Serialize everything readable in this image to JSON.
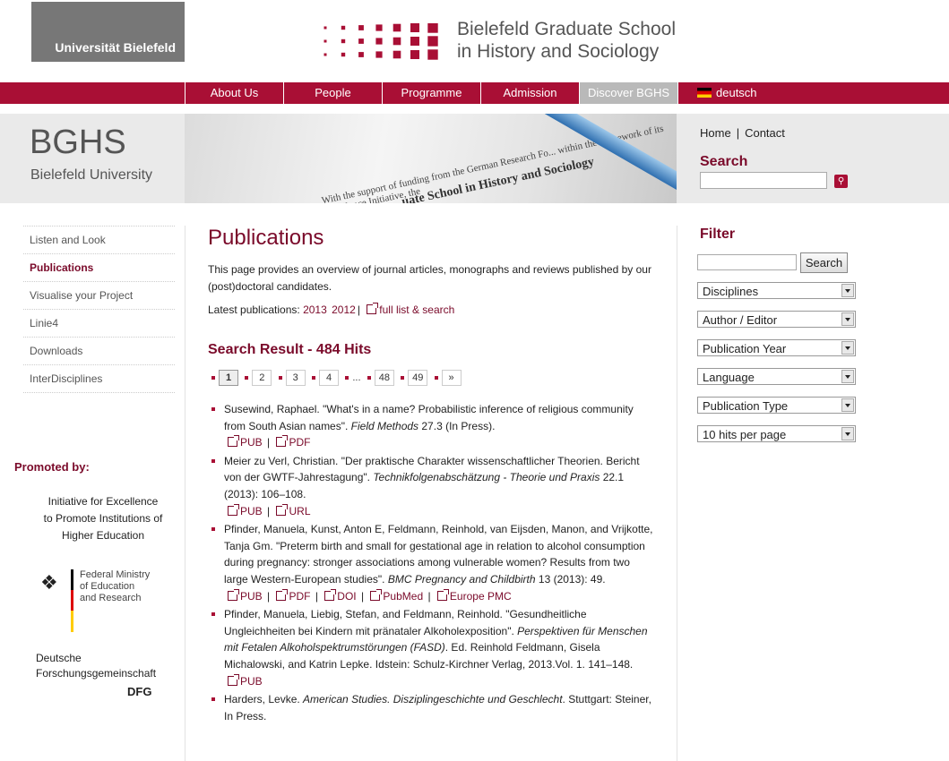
{
  "header": {
    "uni_logo": "Universität Bielefeld",
    "school_title_line1": "Bielefeld Graduate School",
    "school_title_line2": "in History and Sociology"
  },
  "nav": {
    "items": [
      "About Us",
      "People",
      "Programme",
      "Admission",
      "Discover BGHS"
    ],
    "active": "Discover BGHS",
    "language": "deutsch"
  },
  "banner": {
    "title": "BGHS",
    "subtitle": "Bielefeld University",
    "image_text_1": "With the support of funding from the German Research Fo... within the framework of its Excellence Initiative, the",
    "image_text_2": "...uate School in History and Sociology"
  },
  "top_links": {
    "home": "Home",
    "separator": "|",
    "contact": "Contact"
  },
  "search": {
    "label": "Search",
    "value": ""
  },
  "sidebar": {
    "items": [
      {
        "label": "Listen and Look",
        "active": false
      },
      {
        "label": "Publications",
        "active": true
      },
      {
        "label": "Visualise your Project",
        "active": false
      },
      {
        "label": "Linie4",
        "active": false
      },
      {
        "label": "Downloads",
        "active": false
      },
      {
        "label": "InterDisciplines",
        "active": false
      }
    ],
    "promoted_by": "Promoted by:",
    "initiative_l1": "Initiative for Excellence",
    "initiative_l2": "to Promote Institutions of",
    "initiative_l3": "Higher Education",
    "bmbf_l1": "Federal Ministry",
    "bmbf_l2": "of Education",
    "bmbf_l3": "and Research",
    "dfg_l1": "Deutsche",
    "dfg_l2": "Forschungsgemeinschaft",
    "dfg_logo": "DFG"
  },
  "main": {
    "title": "Publications",
    "intro": "This page provides an overview of journal articles, monographs and reviews published by our (post)doctoral candidates.",
    "latest_label": "Latest publications:",
    "latest_years": [
      "2013",
      "2012"
    ],
    "latest_sep": "|",
    "full_list": "full list & search",
    "result_title": "Search Result - 484 Hits",
    "pager": {
      "pages": [
        "1",
        "2",
        "3",
        "4"
      ],
      "ellipsis": "...",
      "tail": [
        "48",
        "49"
      ],
      "next": "»",
      "current": "1"
    },
    "publications": [
      {
        "pre": "Susewind, Raphael. \"What's in a name? Probabilistic inference of religious community from South Asian names\". ",
        "journal": "Field Methods",
        "post": " 27.3 (In Press).",
        "links": [
          "PUB",
          "PDF"
        ]
      },
      {
        "pre": "Meier zu Verl, Christian. \"Der praktische Charakter wissenschaftlicher Theorien. Bericht von der GWTF-Jahrestagung\". ",
        "journal": "Technikfolgenabschätzung - Theorie und Praxis",
        "post": " 22.1 (2013): 106–108.",
        "links": [
          "PUB",
          "URL"
        ]
      },
      {
        "pre": "Pfinder, Manuela, Kunst, Anton E, Feldmann, Reinhold, van Eijsden, Manon, and Vrijkotte, Tanja Gm. \"Preterm birth and small for gestational age in relation to alcohol consumption during pregnancy: stronger associations among vulnerable women? Results from two large Western-European studies\". ",
        "journal": "BMC Pregnancy and Childbirth",
        "post": " 13 (2013): 49.",
        "links": [
          "PUB",
          "PDF",
          "DOI",
          "PubMed",
          "Europe PMC"
        ]
      },
      {
        "pre": "Pfinder, Manuela, Liebig, Stefan, and Feldmann, Reinhold. \"Gesundheitliche Ungleichheiten bei Kindern mit pränataler Alkoholexposition\". ",
        "journal": "Perspektiven für Menschen mit Fetalen Alkoholspektrumstörungen (FASD)",
        "post": ". Ed. Reinhold Feldmann, Gisela Michalowski, and Katrin Lepke. Idstein: Schulz-Kirchner Verlag, 2013.Vol. 1. 141–148.",
        "links": [
          "PUB"
        ]
      },
      {
        "pre": "Harders, Levke. ",
        "journal": "American Studies. Disziplingeschichte und Geschlecht",
        "post": ". Stuttgart: Steiner, In Press.",
        "links": []
      }
    ]
  },
  "filter": {
    "title": "Filter",
    "input_value": "",
    "button": "Search",
    "selects": [
      "Disciplines",
      "Author / Editor",
      "Publication Year",
      "Language",
      "Publication Type",
      "10 hits per page"
    ]
  },
  "colors": {
    "brand": "#a90f35",
    "heading": "#7a0a2a",
    "nav_active": "#b9b9b9"
  }
}
